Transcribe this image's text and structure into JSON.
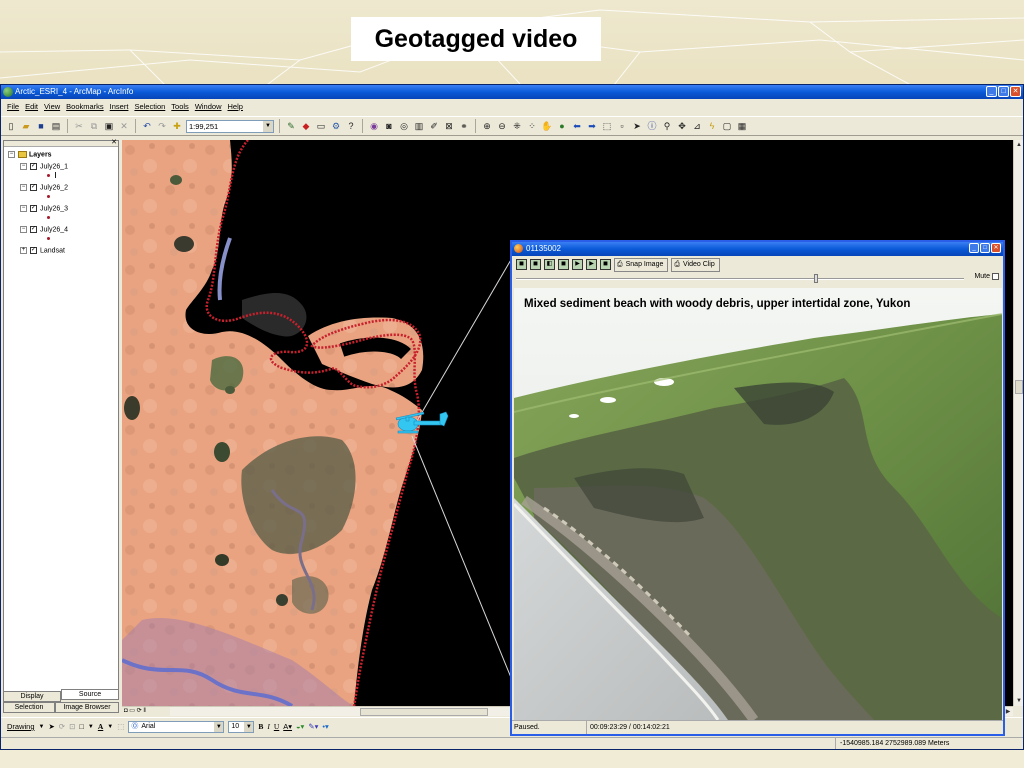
{
  "slide": {
    "title": "Geotagged video"
  },
  "window": {
    "title": "Arctic_ESRI_4 - ArcMap - ArcInfo"
  },
  "menu": [
    "File",
    "Edit",
    "View",
    "Bookmarks",
    "Insert",
    "Selection",
    "Tools",
    "Window",
    "Help"
  ],
  "toolbar": {
    "scale": "1:99,251"
  },
  "toc": {
    "root": "Layers",
    "layers": [
      "July26_1",
      "July26_2",
      "July26_3",
      "July26_4",
      "Landsat"
    ],
    "tabs": {
      "display": "Display",
      "source": "Source",
      "selection": "Selection",
      "image_browser": "Image Browser"
    }
  },
  "drawing": {
    "label": "Drawing",
    "font": "Arial",
    "size": "10",
    "bold": "B",
    "italic": "I",
    "underline": "U",
    "font_color_letter": "A"
  },
  "status": {
    "coords": "-1540985.184  2752989.089 Meters"
  },
  "video": {
    "title": "01135002",
    "snap_label": "Snap Image",
    "clip_label": "Video Clip",
    "mute_label": "Mute",
    "caption": "Mixed sediment beach with woody debris, upper intertidal zone, Yukon",
    "state": "Paused.",
    "timecode": "00:09:23:29 / 00:14:02:21",
    "progress": 0.67
  },
  "colors": {
    "titlebar": "#0a5ad8",
    "track": "#b8192a",
    "helicopter": "#33c6f0",
    "land": "#e8a07f"
  }
}
